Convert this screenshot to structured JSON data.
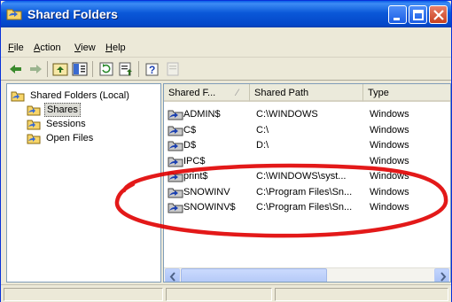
{
  "window": {
    "title": "Shared Folders"
  },
  "menu": [
    {
      "label": "File",
      "accel": "F",
      "rest": "ile"
    },
    {
      "label": "Action",
      "accel": "A",
      "rest": "ction"
    },
    {
      "label": "View",
      "accel": "V",
      "rest": "iew"
    },
    {
      "label": "Help",
      "accel": "H",
      "rest": "elp"
    }
  ],
  "toolbar": {
    "icons": [
      "back-icon",
      "forward-icon",
      "up-folder-icon",
      "show-hide-tree-icon",
      "refresh-icon",
      "export-list-icon",
      "help-icon",
      "properties-icon"
    ]
  },
  "tree": {
    "root": "Shared Folders (Local)",
    "items": [
      {
        "label": "Shares",
        "selected": true
      },
      {
        "label": "Sessions",
        "selected": false
      },
      {
        "label": "Open Files",
        "selected": false
      }
    ]
  },
  "list": {
    "columns": [
      "Shared F...",
      "Shared Path",
      "Type"
    ],
    "rows": [
      {
        "name": "ADMIN$",
        "path": "C:\\WINDOWS",
        "type": "Windows"
      },
      {
        "name": "C$",
        "path": "C:\\",
        "type": "Windows"
      },
      {
        "name": "D$",
        "path": "D:\\",
        "type": "Windows"
      },
      {
        "name": "IPC$",
        "path": "",
        "type": "Windows"
      },
      {
        "name": "print$",
        "path": "C:\\WINDOWS\\syst...",
        "type": "Windows"
      },
      {
        "name": "SNOWINV",
        "path": "C:\\Program Files\\Sn...",
        "type": "Windows"
      },
      {
        "name": "SNOWINV$",
        "path": "C:\\Program Files\\Sn...",
        "type": "Windows"
      }
    ]
  },
  "colors": {
    "titlebar": "#0a58d8",
    "annotation": "#e00000",
    "selection": "#dcdcd6"
  }
}
